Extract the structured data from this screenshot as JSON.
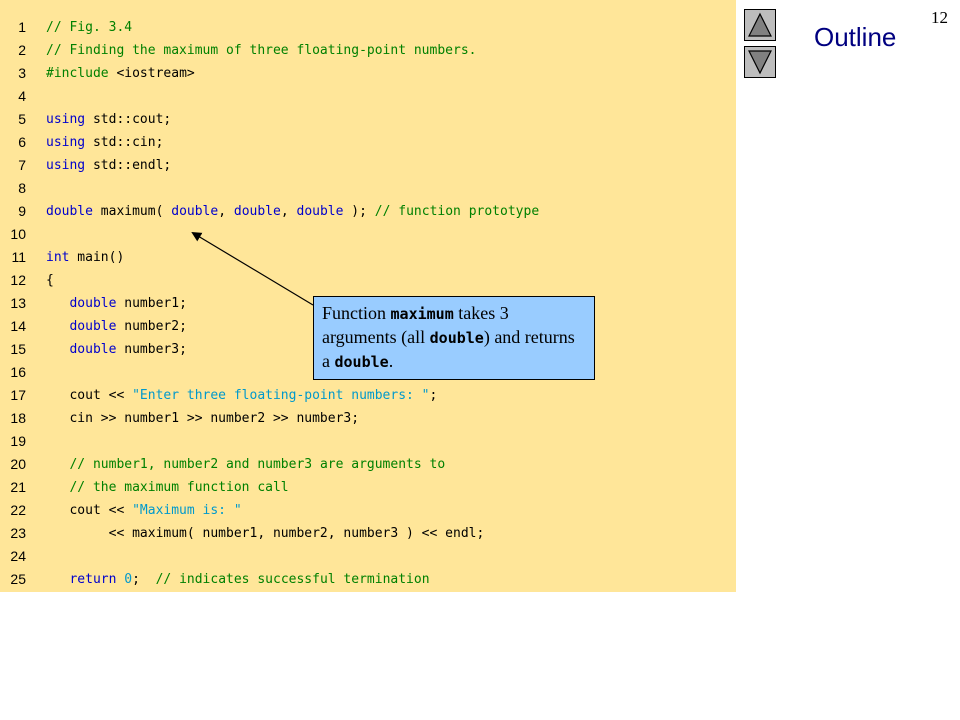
{
  "page_number": "12",
  "outline_label": "Outline",
  "nav": {
    "up_icon": "triangle-up-icon",
    "down_icon": "triangle-down-icon"
  },
  "callout": {
    "prefix": "Function ",
    "code1": "maximum",
    "middle": " takes 3 arguments (all ",
    "code2": "double",
    "middle2": ") and returns a ",
    "code3": "double",
    "suffix": "."
  },
  "colors": {
    "code_background": "#ffe699",
    "keyword": "#0000cc",
    "comment": "#008000",
    "string": "#0099cc",
    "callout_background": "#99ccff",
    "outline_text": "#000080"
  },
  "code_lines": [
    {
      "n": "1",
      "tokens": [
        [
          "cm",
          "// Fig. 3.4"
        ]
      ]
    },
    {
      "n": "2",
      "tokens": [
        [
          "cm",
          "// Finding the maximum of three floating-point numbers."
        ]
      ]
    },
    {
      "n": "3",
      "tokens": [
        [
          "pp",
          "#include "
        ],
        [
          "tx",
          "<iostream>"
        ]
      ]
    },
    {
      "n": "4",
      "tokens": []
    },
    {
      "n": "5",
      "tokens": [
        [
          "kw",
          "using"
        ],
        [
          "tx",
          " std::cout;"
        ]
      ]
    },
    {
      "n": "6",
      "tokens": [
        [
          "kw",
          "using"
        ],
        [
          "tx",
          " std::cin;"
        ]
      ]
    },
    {
      "n": "7",
      "tokens": [
        [
          "kw",
          "using"
        ],
        [
          "tx",
          " std::endl;"
        ]
      ]
    },
    {
      "n": "8",
      "tokens": []
    },
    {
      "n": "9",
      "tokens": [
        [
          "kw",
          "double"
        ],
        [
          "tx",
          " maximum( "
        ],
        [
          "kw",
          "double"
        ],
        [
          "tx",
          ", "
        ],
        [
          "kw",
          "double"
        ],
        [
          "tx",
          ", "
        ],
        [
          "kw",
          "double"
        ],
        [
          "tx",
          " ); "
        ],
        [
          "cm",
          "// function prototype"
        ]
      ]
    },
    {
      "n": "10",
      "tokens": []
    },
    {
      "n": "11",
      "tokens": [
        [
          "kw",
          "int"
        ],
        [
          "tx",
          " main()"
        ]
      ]
    },
    {
      "n": "12",
      "tokens": [
        [
          "tx",
          "{"
        ]
      ]
    },
    {
      "n": "13",
      "tokens": [
        [
          "tx",
          "   "
        ],
        [
          "kw",
          "double"
        ],
        [
          "tx",
          " number1;"
        ]
      ]
    },
    {
      "n": "14",
      "tokens": [
        [
          "tx",
          "   "
        ],
        [
          "kw",
          "double"
        ],
        [
          "tx",
          " number2;"
        ]
      ]
    },
    {
      "n": "15",
      "tokens": [
        [
          "tx",
          "   "
        ],
        [
          "kw",
          "double"
        ],
        [
          "tx",
          " number3;"
        ]
      ]
    },
    {
      "n": "16",
      "tokens": []
    },
    {
      "n": "17",
      "tokens": [
        [
          "tx",
          "   cout << "
        ],
        [
          "str",
          "\"Enter three floating-point numbers: \""
        ],
        [
          "tx",
          ";"
        ]
      ]
    },
    {
      "n": "18",
      "tokens": [
        [
          "tx",
          "   cin >> number1 >> number2 >> number3;"
        ]
      ]
    },
    {
      "n": "19",
      "tokens": []
    },
    {
      "n": "20",
      "tokens": [
        [
          "tx",
          "   "
        ],
        [
          "cm",
          "// number1, number2 and number3 are arguments to"
        ]
      ]
    },
    {
      "n": "21",
      "tokens": [
        [
          "tx",
          "   "
        ],
        [
          "cm",
          "// the maximum function call"
        ]
      ]
    },
    {
      "n": "22",
      "tokens": [
        [
          "tx",
          "   cout << "
        ],
        [
          "str",
          "\"Maximum is: \""
        ]
      ]
    },
    {
      "n": "23",
      "tokens": [
        [
          "tx",
          "        << maximum( number1, number2, number3 ) << endl;"
        ]
      ]
    },
    {
      "n": "24",
      "tokens": []
    },
    {
      "n": "25",
      "tokens": [
        [
          "tx",
          "   "
        ],
        [
          "kw",
          "return"
        ],
        [
          "tx",
          " "
        ],
        [
          "num",
          "0"
        ],
        [
          "tx",
          ";  "
        ],
        [
          "cm",
          "// indicates successful termination"
        ]
      ]
    }
  ]
}
